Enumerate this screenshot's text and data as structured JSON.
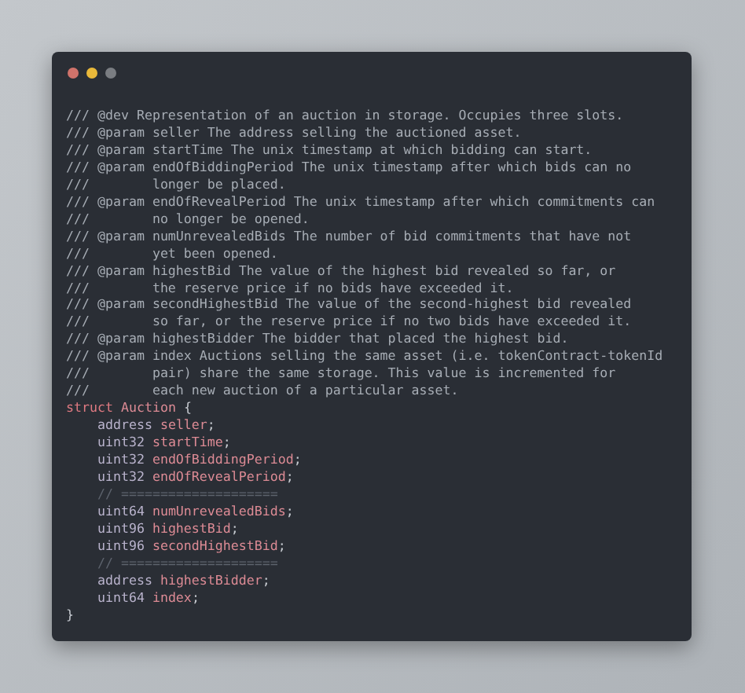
{
  "window": {
    "controls": [
      {
        "kind": "close"
      },
      {
        "kind": "minimize"
      },
      {
        "kind": "zoom"
      }
    ]
  },
  "code_lines": [
    {
      "tokens": [
        {
          "kind": "comment",
          "text": "/// @dev Representation of an auction in storage. Occupies three slots."
        }
      ]
    },
    {
      "tokens": [
        {
          "kind": "comment",
          "text": "/// @param seller The address selling the auctioned asset."
        }
      ]
    },
    {
      "tokens": [
        {
          "kind": "comment",
          "text": "/// @param startTime The unix timestamp at which bidding can start."
        }
      ]
    },
    {
      "tokens": [
        {
          "kind": "comment",
          "text": "/// @param endOfBiddingPeriod The unix timestamp after which bids can no"
        }
      ]
    },
    {
      "tokens": [
        {
          "kind": "comment",
          "text": "///        longer be placed."
        }
      ]
    },
    {
      "tokens": [
        {
          "kind": "comment",
          "text": "/// @param endOfRevealPeriod The unix timestamp after which commitments can"
        }
      ]
    },
    {
      "tokens": [
        {
          "kind": "comment",
          "text": "///        no longer be opened."
        }
      ]
    },
    {
      "tokens": [
        {
          "kind": "comment",
          "text": "/// @param numUnrevealedBids The number of bid commitments that have not"
        }
      ]
    },
    {
      "tokens": [
        {
          "kind": "comment",
          "text": "///        yet been opened."
        }
      ]
    },
    {
      "tokens": [
        {
          "kind": "comment",
          "text": "/// @param highestBid The value of the highest bid revealed so far, or"
        }
      ]
    },
    {
      "tokens": [
        {
          "kind": "comment",
          "text": "///        the reserve price if no bids have exceeded it."
        }
      ]
    },
    {
      "tokens": [
        {
          "kind": "comment",
          "text": "/// @param secondHighestBid The value of the second-highest bid revealed"
        }
      ]
    },
    {
      "tokens": [
        {
          "kind": "comment",
          "text": "///        so far, or the reserve price if no two bids have exceeded it."
        }
      ]
    },
    {
      "tokens": [
        {
          "kind": "comment",
          "text": "/// @param highestBidder The bidder that placed the highest bid."
        }
      ]
    },
    {
      "tokens": [
        {
          "kind": "comment",
          "text": "/// @param index Auctions selling the same asset (i.e. tokenContract-tokenId"
        }
      ]
    },
    {
      "tokens": [
        {
          "kind": "comment",
          "text": "///        pair) share the same storage. This value is incremented for"
        }
      ]
    },
    {
      "tokens": [
        {
          "kind": "comment",
          "text": "///        each new auction of a particular asset."
        }
      ]
    },
    {
      "tokens": [
        {
          "kind": "keyword",
          "text": "struct"
        },
        {
          "kind": "name",
          "text": " Auction"
        },
        {
          "kind": "punct",
          "text": " {"
        }
      ]
    },
    {
      "tokens": [
        {
          "kind": "type",
          "text": "    address"
        },
        {
          "kind": "name",
          "text": " seller"
        },
        {
          "kind": "punct",
          "text": ";"
        }
      ]
    },
    {
      "tokens": [
        {
          "kind": "type",
          "text": "    uint32"
        },
        {
          "kind": "name",
          "text": " startTime"
        },
        {
          "kind": "punct",
          "text": ";"
        }
      ]
    },
    {
      "tokens": [
        {
          "kind": "type",
          "text": "    uint32"
        },
        {
          "kind": "name",
          "text": " endOfBiddingPeriod"
        },
        {
          "kind": "punct",
          "text": ";"
        }
      ]
    },
    {
      "tokens": [
        {
          "kind": "type",
          "text": "    uint32"
        },
        {
          "kind": "name",
          "text": " endOfRevealPeriod"
        },
        {
          "kind": "punct",
          "text": ";"
        }
      ]
    },
    {
      "tokens": [
        {
          "kind": "divider",
          "text": "    // ===================="
        }
      ]
    },
    {
      "tokens": [
        {
          "kind": "type",
          "text": "    uint64"
        },
        {
          "kind": "name",
          "text": " numUnrevealedBids"
        },
        {
          "kind": "punct",
          "text": ";"
        }
      ]
    },
    {
      "tokens": [
        {
          "kind": "type",
          "text": "    uint96"
        },
        {
          "kind": "name",
          "text": " highestBid"
        },
        {
          "kind": "punct",
          "text": ";"
        }
      ]
    },
    {
      "tokens": [
        {
          "kind": "type",
          "text": "    uint96"
        },
        {
          "kind": "name",
          "text": " secondHighestBid"
        },
        {
          "kind": "punct",
          "text": ";"
        }
      ]
    },
    {
      "tokens": [
        {
          "kind": "divider",
          "text": "    // ===================="
        }
      ]
    },
    {
      "tokens": [
        {
          "kind": "type",
          "text": "    address"
        },
        {
          "kind": "name",
          "text": " highestBidder"
        },
        {
          "kind": "punct",
          "text": ";"
        }
      ]
    },
    {
      "tokens": [
        {
          "kind": "type",
          "text": "    uint64"
        },
        {
          "kind": "name",
          "text": " index"
        },
        {
          "kind": "punct",
          "text": ";"
        }
      ]
    },
    {
      "tokens": [
        {
          "kind": "punct",
          "text": "}"
        }
      ]
    }
  ]
}
